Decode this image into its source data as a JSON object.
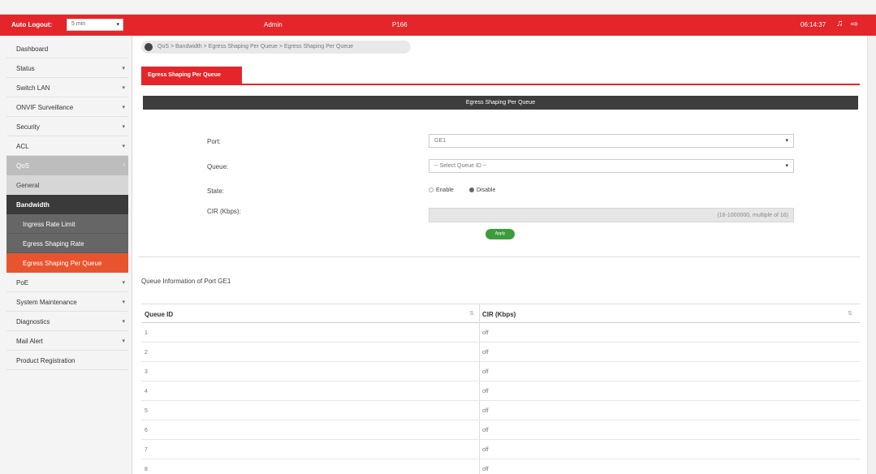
{
  "header": {
    "auto_logout_label": "Auto Logout:",
    "auto_logout_value": "5 min",
    "user": "Admin",
    "model": "P166",
    "time": "06:14:37",
    "accent_color": "#e4262b"
  },
  "sidebar": {
    "items": [
      {
        "label": "Dashboard"
      },
      {
        "label": "Status"
      },
      {
        "label": "Switch LAN"
      },
      {
        "label": "ONVIF Surveillance"
      },
      {
        "label": "Security"
      },
      {
        "label": "ACL"
      },
      {
        "label": "QoS"
      },
      {
        "label": "General"
      },
      {
        "label": "Bandwidth"
      },
      {
        "label": "Ingress Rate Limit"
      },
      {
        "label": "Egress Shaping Rate"
      },
      {
        "label": "Egress Shaping Per Queue"
      },
      {
        "label": "PoE"
      },
      {
        "label": "System Maintenance"
      },
      {
        "label": "Diagnostics"
      },
      {
        "label": "Mail Alert"
      },
      {
        "label": "Product Registration"
      }
    ]
  },
  "breadcrumb": "QoS > Bandwidth > Egress Shaping Per Queue > Egress Shaping Per Queue",
  "tab": "Egress Shaping Per Queue",
  "section_title": "Egress Shaping Per Queue",
  "form": {
    "port_label": "Port:",
    "port_value": "GE1",
    "queue_label": "Queue:",
    "queue_value": "-- Select Queue ID --",
    "state_label": "State:",
    "state_enable": "Enable",
    "state_disable": "Disable",
    "state_selected": "Disable",
    "cir_label": "CIR (Kbps):",
    "cir_hint": "(16-1000000, multiple of 16)",
    "apply_label": "Apply"
  },
  "queue_info_title": "Queue Information of Port GE1",
  "table": {
    "headers": [
      "Queue ID",
      "CIR (Kbps)"
    ],
    "rows": [
      [
        "1",
        "off"
      ],
      [
        "2",
        "off"
      ],
      [
        "3",
        "off"
      ],
      [
        "4",
        "off"
      ],
      [
        "5",
        "off"
      ],
      [
        "6",
        "off"
      ],
      [
        "7",
        "off"
      ],
      [
        "8",
        "off"
      ]
    ]
  }
}
